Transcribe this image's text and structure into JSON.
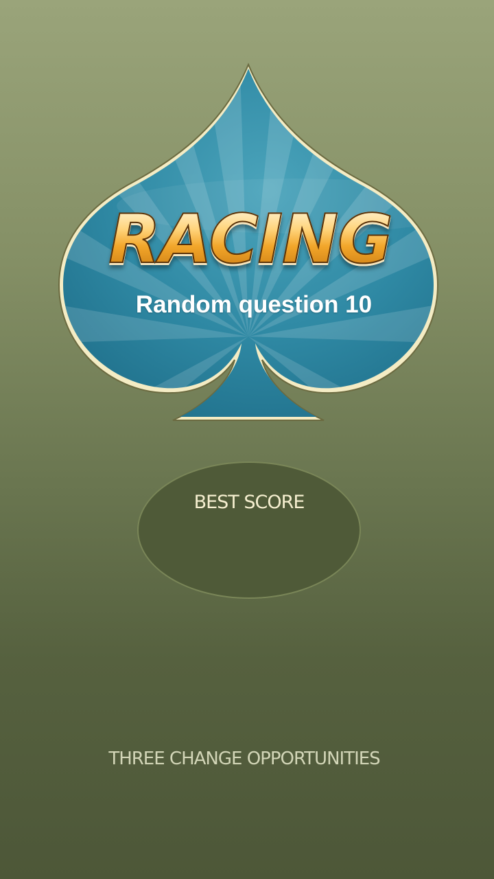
{
  "logo": {
    "title": "RACING",
    "subtitle": "Random question 10",
    "icon": "spade-icon",
    "spade_color": "#2c86a2",
    "outline_color": "#f4ecc4"
  },
  "best_score": {
    "label": "BEST SCORE",
    "value": ""
  },
  "footer": {
    "text": "THREE CHANGE OPPORTUNITIES"
  }
}
